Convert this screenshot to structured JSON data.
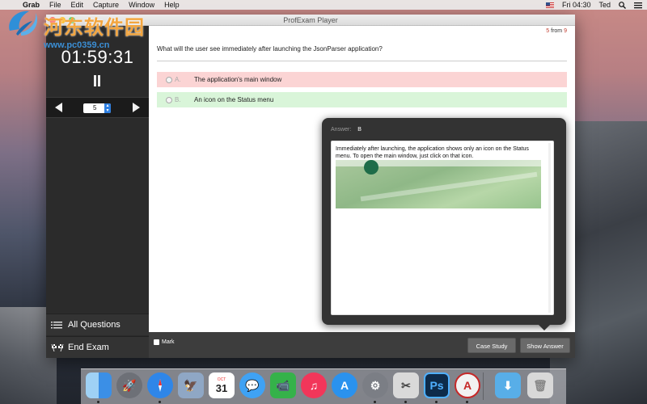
{
  "menubar": {
    "app": "Grab",
    "items": [
      "File",
      "Edit",
      "Capture",
      "Window",
      "Help"
    ],
    "clock": "Fri 04:30",
    "user": "Ted"
  },
  "watermark": {
    "title": "河东软件园",
    "url": "www.pc0359.cn"
  },
  "window": {
    "title": "ProfExam Player"
  },
  "sidebar": {
    "timer": "01:59:31",
    "question_number": "5",
    "all_questions_label": "All Questions",
    "end_exam_label": "End Exam"
  },
  "content": {
    "counter_current": "5",
    "counter_sep": "from",
    "counter_total": "9",
    "question": "What will the user see immediately after launching the JsonParser application?",
    "options": [
      {
        "letter": "A.",
        "text": "The application's main window",
        "status": "wrong"
      },
      {
        "letter": "B.",
        "text": "An icon on the Status menu",
        "status": "correct"
      }
    ]
  },
  "answer": {
    "label": "Answer:",
    "value": "B",
    "explanation": "Immediately after launching, the application shows only an icon on the Status menu. To open the main window, just click on that icon."
  },
  "toolbar": {
    "mark_label": "Mark",
    "case_study_label": "Case Study",
    "show_answer_label": "Show Answer"
  },
  "dock": {
    "items": [
      {
        "name": "finder-icon",
        "color": "#3b8fe6"
      },
      {
        "name": "launchpad-icon",
        "color": "#6d7077"
      },
      {
        "name": "safari-icon",
        "color": "#2f86e8"
      },
      {
        "name": "preview-icon",
        "color": "#8fa7c5"
      },
      {
        "name": "calendar-icon",
        "color": "#ffffff"
      },
      {
        "name": "messages-icon",
        "color": "#3fa2f4"
      },
      {
        "name": "facetime-icon",
        "color": "#35b24a"
      },
      {
        "name": "itunes-icon",
        "color": "#f2365a"
      },
      {
        "name": "app-store-icon",
        "color": "#2a92ee"
      },
      {
        "name": "system-preferences-icon",
        "color": "#7b7e85"
      },
      {
        "name": "grab-icon",
        "color": "#d9d9d9"
      },
      {
        "name": "photoshop-icon",
        "color": "#0d2b4a"
      },
      {
        "name": "profexam-icon",
        "color": "#f2f2f2"
      },
      {
        "name": "downloads-folder-icon",
        "color": "#58aee8"
      },
      {
        "name": "trash-icon",
        "color": "#d8d8d8"
      }
    ],
    "calendar_month": "OCT",
    "calendar_day": "31",
    "photoshop_label": "Ps"
  }
}
